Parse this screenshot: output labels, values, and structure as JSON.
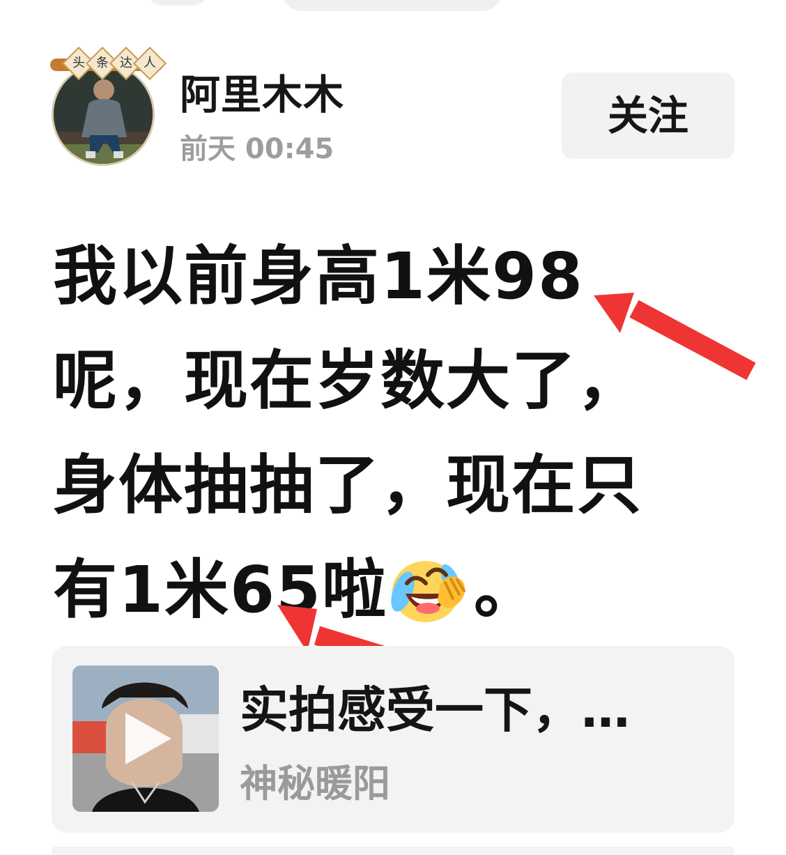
{
  "author": {
    "name": "阿里木木",
    "badge_chars": [
      "头",
      "条",
      "达",
      "人"
    ],
    "time": "前天  00:45",
    "follow_label": "关注"
  },
  "post": {
    "lines": [
      "我以前身高1米98",
      "呢，现在岁数大了，",
      "身体抽抽了，现在只",
      "有1米65啦"
    ],
    "line4_suffix": "。",
    "emoji_icon": "laughing-crying-face-icon"
  },
  "video_card": {
    "title": "实拍感受一下，…",
    "author": "神秘暖阳",
    "play_icon": "play-icon"
  },
  "colors": {
    "arrow_red": "#ef3434",
    "muted_gray": "#9d9d9d",
    "card_bg": "#f3f3f3",
    "button_bg": "#f2f2f2"
  }
}
